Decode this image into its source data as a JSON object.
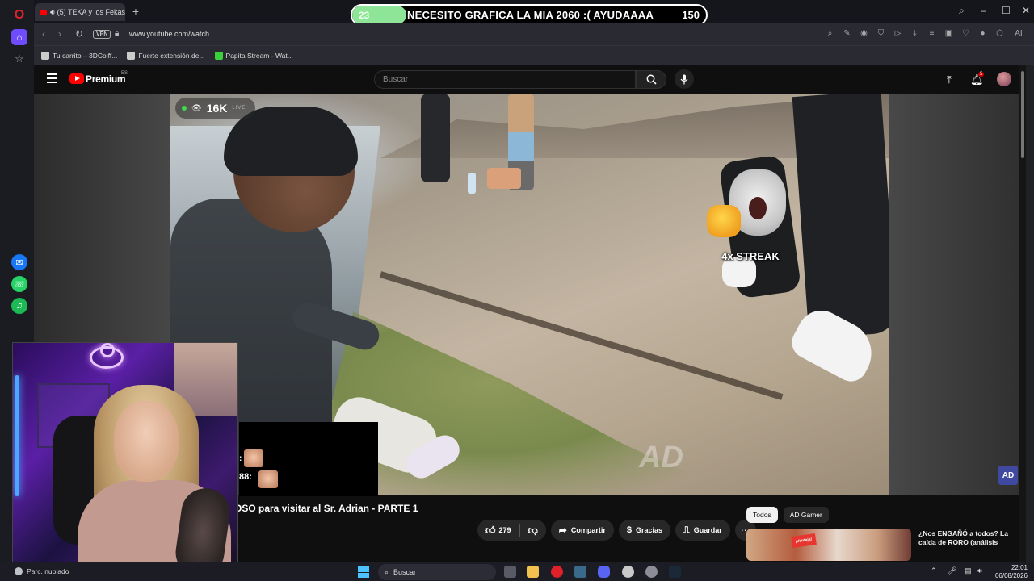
{
  "browser": {
    "tab_title": "(5) TEKA y los Fekas v...",
    "url": "www.youtube.com/watch",
    "vpn_label": "VPN",
    "ai_label": "AI",
    "bookmarks": [
      {
        "label": "Tu carrito – 3DCoiff..."
      },
      {
        "label": "Fuerte extensión de..."
      },
      {
        "label": "Papita Stream - Wat..."
      }
    ]
  },
  "stream_goal": {
    "current": "23",
    "target": "150",
    "progress_fraction": 0.153,
    "text": "NECESITO GRAFICA LA MIA 2060 :( AYUDAAAA",
    "fill_color": "#8ee597"
  },
  "youtube": {
    "brand": "Premium",
    "country": "ES",
    "search_placeholder": "Buscar",
    "notifications_count": "5",
    "viewers": "16K",
    "viewers_sub": "LIVE",
    "streak_label": "4x STREAK",
    "watermark": "AD",
    "channel_watermark": "AD",
    "video_title": "OSO para visitar al Sr. Adrian - PARTE 1",
    "actions": {
      "likes": "279",
      "share": "Compartir",
      "thanks": "Gracias",
      "save": "Guardar"
    },
    "chips": [
      {
        "label": "Todos",
        "active": true
      },
      {
        "label": "AD Gamer",
        "active": false
      }
    ],
    "recommendation": {
      "title": "¿Nos ENGAÑÓ a todos? La caída de RORO (análisis",
      "thumb_tag": "¡Ventaja!"
    }
  },
  "stream_overlay": {
    "chat_fragment": "88:",
    "chat_colon": ":"
  },
  "taskbar": {
    "weather": "Parc. nublado",
    "search_label": "Buscar",
    "time": "22:01",
    "date": "06/08/2026"
  }
}
